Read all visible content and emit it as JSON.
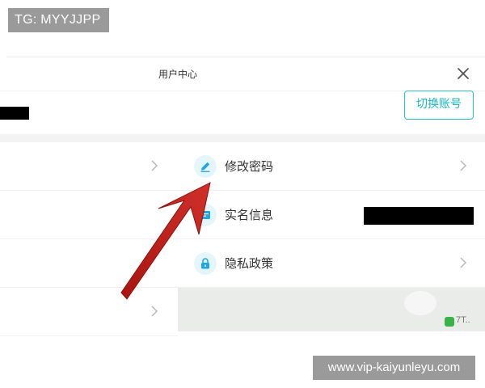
{
  "overlay": {
    "tg_badge": "TG: MYYJJPP",
    "watermark": "www.vip-kaiyunleyu.com"
  },
  "header": {
    "title": "用户中心",
    "close_icon": "close-icon"
  },
  "account": {
    "switch_label": "切换账号"
  },
  "menu": {
    "items": [
      {
        "label": "修改密码",
        "icon": "pencil-icon"
      },
      {
        "label": "实名信息",
        "icon": "id-card-icon"
      },
      {
        "label": "隐私政策",
        "icon": "lock-icon"
      }
    ]
  },
  "brand": {
    "logo_text": "7T.."
  },
  "colors": {
    "accent": "#25c2c9",
    "icon_bg": "#e4f5fb",
    "annotation_arrow": "#c0201a",
    "overlay_grey": "#9a9a9a"
  }
}
